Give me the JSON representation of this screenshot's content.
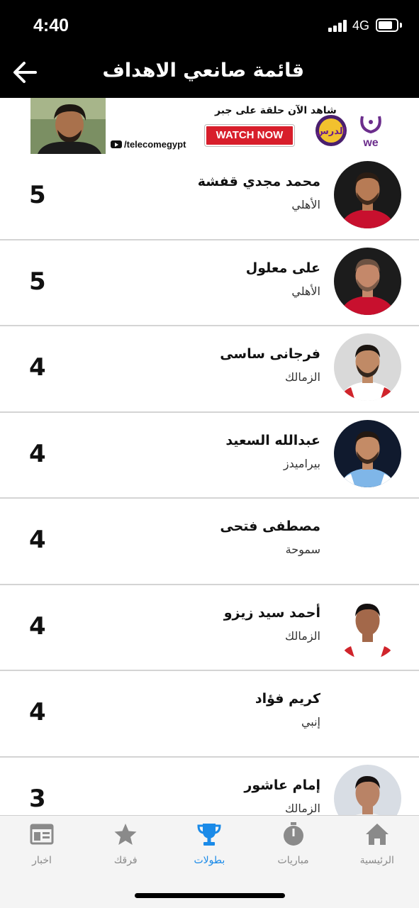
{
  "status_bar": {
    "time": "4:40",
    "network": "4G",
    "battery_level": 0.8
  },
  "header": {
    "title": "قائمة صانعي الاهداف",
    "back_icon": "arrow-left-icon"
  },
  "ad": {
    "headline": "شاهد الآن حلقة على جبر",
    "cta_label": "WATCH NOW",
    "channel": "/telecomegypt",
    "show_logo_text": "الدرس",
    "brand_logo_text": "we"
  },
  "players": [
    {
      "name": "محمد مجدي  قفشة",
      "team": "الأهلي",
      "goals": "5",
      "photo": "avatar-ahly-1"
    },
    {
      "name": "على معلول",
      "team": "الأهلي",
      "goals": "5",
      "photo": "avatar-ahly-2"
    },
    {
      "name": "فرجانى ساسى",
      "team": "الزمالك",
      "goals": "4",
      "photo": "avatar-zamalek-1"
    },
    {
      "name": "عبدالله السعيد",
      "team": "بيراميدز",
      "goals": "4",
      "photo": "avatar-pyramids"
    },
    {
      "name": "مصطفى فتحى",
      "team": "سموحة",
      "goals": "4",
      "photo": ""
    },
    {
      "name": "أحمد سيد زيزو",
      "team": "الزمالك",
      "goals": "4",
      "photo": "avatar-zamalek-2"
    },
    {
      "name": "كريم فؤاد",
      "team": "إنبي",
      "goals": "4",
      "photo": ""
    },
    {
      "name": "إمام عاشور",
      "team": "الزمالك",
      "goals": "3",
      "photo": "avatar-zamalek-3"
    }
  ],
  "tabs": [
    {
      "label": "اخبار",
      "icon": "news-icon",
      "active": false
    },
    {
      "label": "فرقك",
      "icon": "star-icon",
      "active": false
    },
    {
      "label": "بطولات",
      "icon": "trophy-icon",
      "active": true
    },
    {
      "label": "مباريات",
      "icon": "stopwatch-icon",
      "active": false
    },
    {
      "label": "الرئيسية",
      "icon": "home-icon",
      "active": false
    }
  ],
  "colors": {
    "active_tab": "#1a8ae8",
    "inactive_tab": "#8a8a8a",
    "header_bg": "#000000",
    "cta_red": "#d81e2b"
  }
}
